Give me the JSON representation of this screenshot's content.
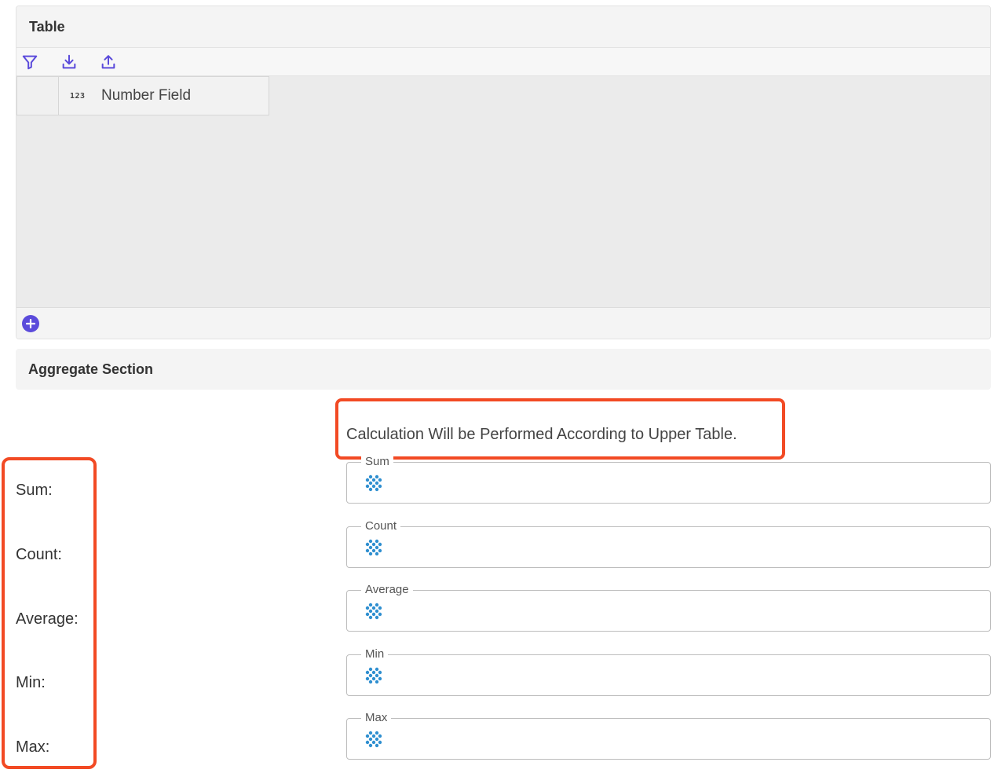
{
  "table_section": {
    "title": "Table",
    "toolbar": {
      "filter_icon": "filter-icon",
      "download_icon": "download-icon",
      "upload_icon": "upload-icon"
    },
    "columns": [
      {
        "type_icon": "123",
        "label": "Number Field"
      }
    ],
    "add_row_icon": "plus-circle-icon"
  },
  "aggregate_section": {
    "title": "Aggregate Section",
    "note": "Calculation Will be Performed According to Upper Table.",
    "labels": [
      "Sum:",
      "Count:",
      "Average:",
      "Min:",
      "Max:"
    ],
    "fields": [
      {
        "legend": "Sum",
        "value": ""
      },
      {
        "legend": "Count",
        "value": ""
      },
      {
        "legend": "Average",
        "value": ""
      },
      {
        "legend": "Min",
        "value": ""
      },
      {
        "legend": "Max",
        "value": ""
      }
    ]
  },
  "colors": {
    "accent": "#5b4bdb",
    "highlight": "#f24a24",
    "loading_icon": "#2f8fd0"
  }
}
